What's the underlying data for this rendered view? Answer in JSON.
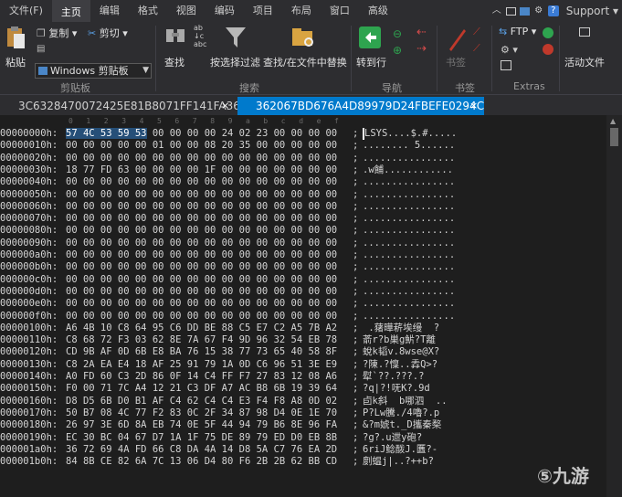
{
  "menu": [
    "文件(F)",
    "主页",
    "编辑",
    "格式",
    "视图",
    "编码",
    "项目",
    "布局",
    "窗口",
    "高级"
  ],
  "support_label": "Support",
  "ribbon": {
    "paste": "粘贴",
    "copy": "复制",
    "cut": "剪切",
    "clipboard_select": "Windows 剪贴板",
    "clipboard_group": "剪贴板",
    "find": "查找",
    "find_filter": "按选择过滤",
    "find_in_files": "查找/在文件中替换",
    "search_group": "搜索",
    "goto": "转到行",
    "nav_group": "导航",
    "bookmarks": "书签",
    "bookmarks_group": "书签",
    "ftp": "FTP",
    "extras_group": "Extras",
    "active_file": "活动文件"
  },
  "tabs": {
    "inactive": "3C6328470072425E81B8071FF141FA36",
    "active": "362067BD676A4D89979D24FBEFE0294C",
    "close": "×"
  },
  "ruler": [
    "0",
    "1",
    "2",
    "3",
    "4",
    "5",
    "6",
    "7",
    "8",
    "9",
    "a",
    "b",
    "c",
    "d",
    "e",
    "f"
  ],
  "rows": [
    {
      "addr": "00000000h:",
      "hex": "00 00 00 00 24 02 23 00 00 00 00",
      "hexsel": "57 4C 53 59 53",
      "asc": "LSYS....$.#....."
    },
    {
      "addr": "00000010h:",
      "hex": "00 00 00 00 00 01 00 00 08 20 35 00 00 00 00 00",
      "asc": "........ 5......"
    },
    {
      "addr": "00000020h:",
      "hex": "00 00 00 00 00 00 00 00 00 00 00 00 00 00 00 00",
      "asc": "................"
    },
    {
      "addr": "00000030h:",
      "hex": "18 77 FD 63 00 00 00 00 1F 00 00 00 00 00 00 00",
      "asc": ".w餔............"
    },
    {
      "addr": "00000040h:",
      "hex": "00 00 00 00 00 00 00 00 00 00 00 00 00 00 00 00",
      "asc": "................"
    },
    {
      "addr": "00000050h:",
      "hex": "00 00 00 00 00 00 00 00 00 00 00 00 00 00 00 00",
      "asc": "................"
    },
    {
      "addr": "00000060h:",
      "hex": "00 00 00 00 00 00 00 00 00 00 00 00 00 00 00 00",
      "asc": "................"
    },
    {
      "addr": "00000070h:",
      "hex": "00 00 00 00 00 00 00 00 00 00 00 00 00 00 00 00",
      "asc": "................"
    },
    {
      "addr": "00000080h:",
      "hex": "00 00 00 00 00 00 00 00 00 00 00 00 00 00 00 00",
      "asc": "................"
    },
    {
      "addr": "00000090h:",
      "hex": "00 00 00 00 00 00 00 00 00 00 00 00 00 00 00 00",
      "asc": "................"
    },
    {
      "addr": "000000a0h:",
      "hex": "00 00 00 00 00 00 00 00 00 00 00 00 00 00 00 00",
      "asc": "................"
    },
    {
      "addr": "000000b0h:",
      "hex": "00 00 00 00 00 00 00 00 00 00 00 00 00 00 00 00",
      "asc": "................"
    },
    {
      "addr": "000000c0h:",
      "hex": "00 00 00 00 00 00 00 00 00 00 00 00 00 00 00 00",
      "asc": "................"
    },
    {
      "addr": "000000d0h:",
      "hex": "00 00 00 00 00 00 00 00 00 00 00 00 00 00 00 00",
      "asc": "................"
    },
    {
      "addr": "000000e0h:",
      "hex": "00 00 00 00 00 00 00 00 00 00 00 00 00 00 00 00",
      "asc": "................"
    },
    {
      "addr": "000000f0h:",
      "hex": "00 00 00 00 00 00 00 00 00 00 00 00 00 00 00 00",
      "asc": "................"
    },
    {
      "addr": "00000100h:",
      "hex": "A6 4B 10 C8 64 95 C6 DD BE 88 C5 E7 C2 A5 7B A2",
      "asc": " .蕏曄菥埃缦  ?"
    },
    {
      "addr": "00000110h:",
      "hex": "C8 68 72 F3 03 62 8E 7A 67 F4 9D 96 32 54 EB 78",
      "asc": "萮r?b巣g魸?T離"
    },
    {
      "addr": "00000120h:",
      "hex": "CD 9B AF 0D 6B E8 BA 76 15 38 77 73 65 40 58 8F",
      "asc": "蛻k韬v.8wse@X?"
    },
    {
      "addr": "00000130h:",
      "hex": "C8 2A EA E4 18 AF 25 91 79 1A 0D C6 96 51 3E E9",
      "asc": "?陳.?懍..掱Q>?"
    },
    {
      "addr": "00000140h:",
      "hex": "A0 FD 60 C3 2D 86 0F 14 C4 FF F7 27 83 12 08 A6",
      "asc": "犚`??.???.?"
    },
    {
      "addr": "00000150h:",
      "hex": "F0 00 71 7C A4 12 21 C3 DF A7 AC B8 6B 19 39 64",
      "asc": "?q|?!呒K?.9d"
    },
    {
      "addr": "00000160h:",
      "hex": "D8 D5 6B D0 B1 AF C4 62 C4 C4 E3 F4 F8 A8 0D 02",
      "asc": "卣k斜  b哪泗  .."
    },
    {
      "addr": "00000170h:",
      "hex": "50 B7 08 4C 77 F2 83 0C 2F 34 87 98 D4 0E 1E 70",
      "asc": "P?Lw騰./4嚕?.p"
    },
    {
      "addr": "00000180h:",
      "hex": "26 97 3E 6D 8A EB 74 0E 5F 44 94 79 B6 8E 96 FA",
      "asc": "&?m婋t._D攜秦楘"
    },
    {
      "addr": "00000190h:",
      "hex": "EC 30 BC 04 67 D7 1A 1F 75 DE 89 79 ED D0 EB 8B",
      "asc": "?g?.u迣y砲?"
    },
    {
      "addr": "000001a0h:",
      "hex": "36 72 69 4A FD 66 C8 DA 4A 14 D8 5A C7 76 EA 2D",
      "asc": "6riJ鲶酦J.匶?-"
    },
    {
      "addr": "000001b0h:",
      "hex": "84 8B CE 82 6A 7C 13 06 D4 80 F6 2B 2B 62 BB CD",
      "asc": "剫蝹j|..?++b?"
    }
  ]
}
